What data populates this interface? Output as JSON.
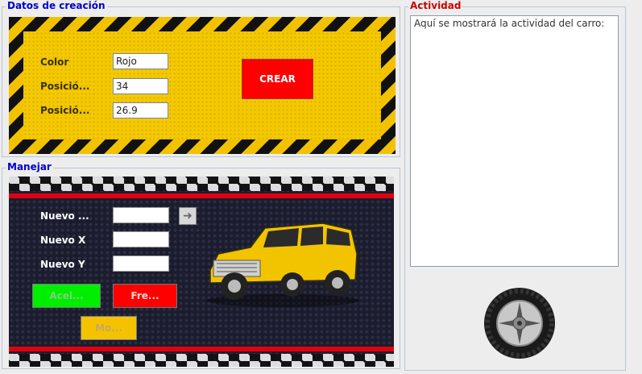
{
  "datos": {
    "title": "Datos de creación",
    "title_color": "#0000cc",
    "fields": [
      {
        "label": "Color",
        "value": "Rojo"
      },
      {
        "label": "Posició...",
        "value": "34"
      },
      {
        "label": "Posició...",
        "value": "26.9"
      }
    ],
    "crear_label": "CREAR"
  },
  "manejar": {
    "title": "Manejar",
    "title_color": "#0000cc",
    "fields": [
      {
        "label": "Nuevo ...",
        "value": ""
      },
      {
        "label": "Nuevo X",
        "value": ""
      },
      {
        "label": "Nuevo Y",
        "value": ""
      }
    ],
    "arrow_icon": "arrow-right-icon",
    "accel_label": "Acel...",
    "freno_label": "Fre...",
    "mover_label": "Mo...",
    "accel_color": "#00ee00",
    "freno_color": "#ff0000",
    "mover_color": "#f5c200"
  },
  "actividad": {
    "title": "Actividad",
    "title_color": "#cc0000",
    "text": "Aquí se mostrará la actividad del carro:",
    "wheel_icon": "tire-icon"
  }
}
